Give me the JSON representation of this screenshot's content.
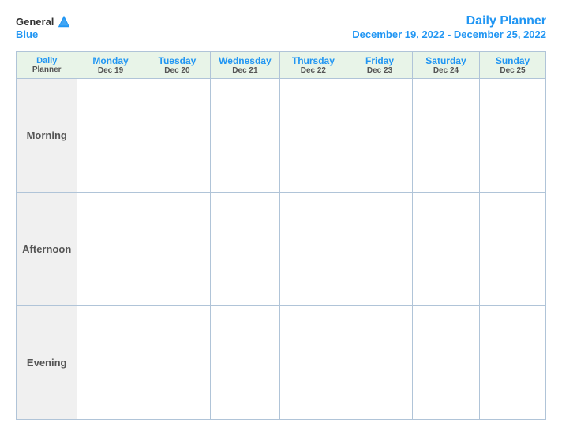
{
  "header": {
    "logo": {
      "general": "General",
      "blue": "Blue",
      "icon_title": "GeneralBlue logo"
    },
    "title_line1": "Daily Planner",
    "title_line2": "December 19, 2022 - December 25, 2022"
  },
  "calendar": {
    "columns": [
      {
        "id": "label",
        "day_name": "Daily",
        "day_name2": "Planner",
        "date": ""
      },
      {
        "id": "mon",
        "day_name": "Monday",
        "date": "Dec 19"
      },
      {
        "id": "tue",
        "day_name": "Tuesday",
        "date": "Dec 20"
      },
      {
        "id": "wed",
        "day_name": "Wednesday",
        "date": "Dec 21"
      },
      {
        "id": "thu",
        "day_name": "Thursday",
        "date": "Dec 22"
      },
      {
        "id": "fri",
        "day_name": "Friday",
        "date": "Dec 23"
      },
      {
        "id": "sat",
        "day_name": "Saturday",
        "date": "Dec 24"
      },
      {
        "id": "sun",
        "day_name": "Sunday",
        "date": "Dec 25"
      }
    ],
    "rows": [
      {
        "id": "morning",
        "label": "Morning"
      },
      {
        "id": "afternoon",
        "label": "Afternoon"
      },
      {
        "id": "evening",
        "label": "Evening"
      }
    ]
  }
}
